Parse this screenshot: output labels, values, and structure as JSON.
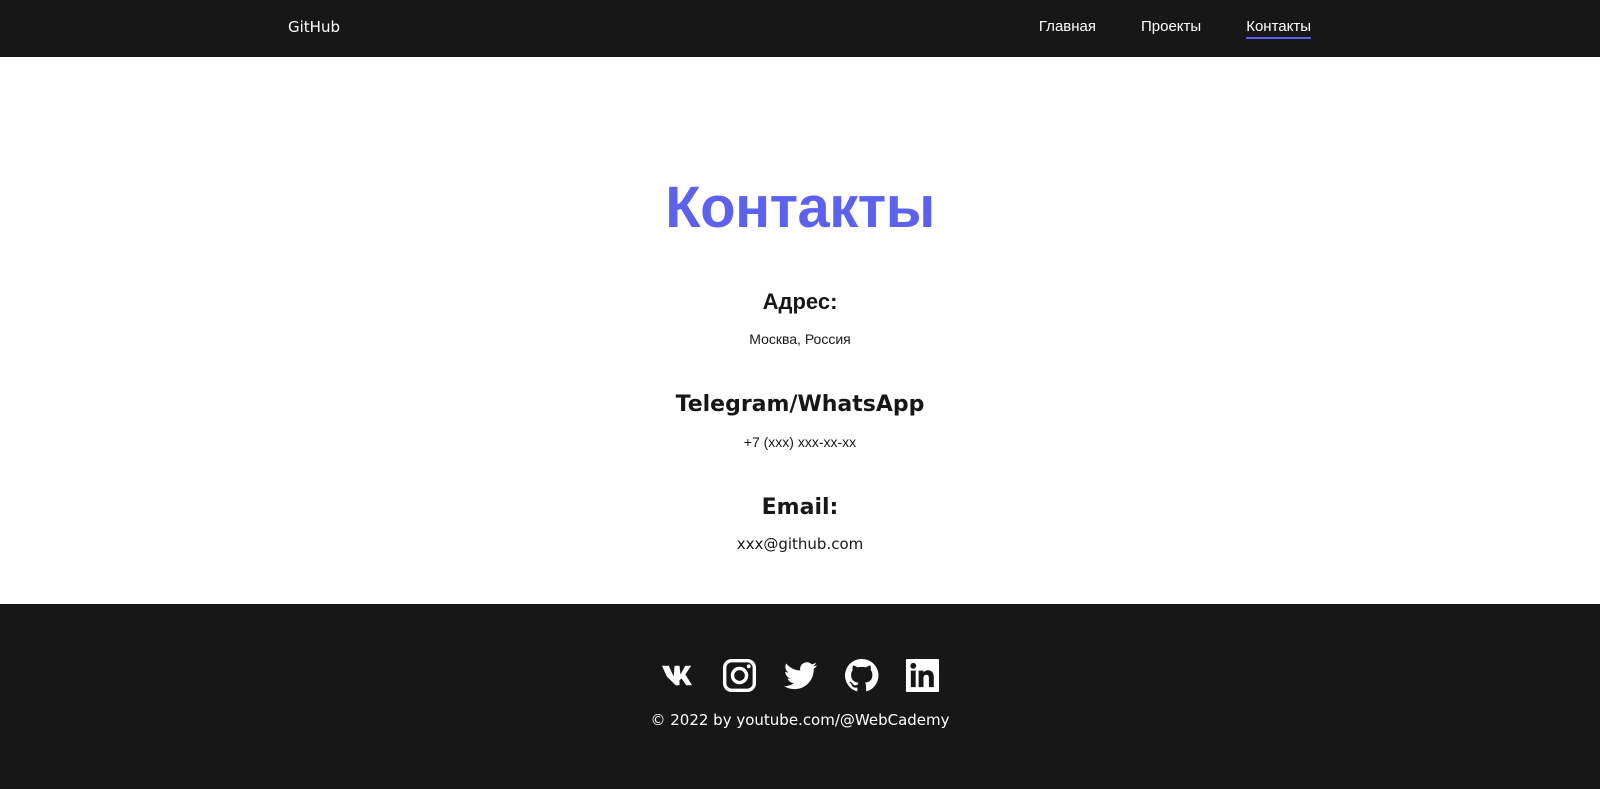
{
  "header": {
    "logo": "GitHub",
    "nav": [
      {
        "label": "Главная"
      },
      {
        "label": "Проекты"
      },
      {
        "label": "Контакты",
        "active": true
      }
    ]
  },
  "main": {
    "title": "Контакты",
    "sections": [
      {
        "heading": "Адрес:",
        "value": "Москва, Россия"
      },
      {
        "heading": "Telegram/WhatsApp",
        "value": "+7 (xxx) xxx-xx-xx"
      },
      {
        "heading": "Email:",
        "value": "xxx@github.com"
      }
    ]
  },
  "footer": {
    "socials": [
      "vk-icon",
      "instagram-icon",
      "twitter-icon",
      "github-icon",
      "linkedin-icon"
    ],
    "copyright": "© 2022 by youtube.com/@WebCademy"
  },
  "colors": {
    "accent": "#5c62ec",
    "dark": "#171718",
    "light": "#ffffff"
  }
}
